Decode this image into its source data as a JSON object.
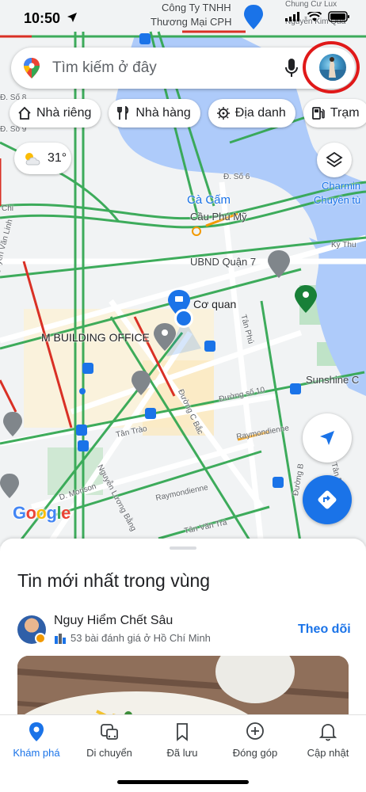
{
  "status": {
    "time": "10:50"
  },
  "search": {
    "placeholder": "Tìm kiếm ở đây"
  },
  "chips": [
    {
      "label": "Nhà riêng",
      "icon": "home-icon"
    },
    {
      "label": "Nhà hàng",
      "icon": "restaurant-icon"
    },
    {
      "label": "Địa danh",
      "icon": "landmark-icon"
    },
    {
      "label": "Trạm",
      "icon": "gas-station-icon"
    }
  ],
  "weather": {
    "temp": "31°"
  },
  "map": {
    "labels": {
      "cong_ty_1": "Công Ty TNHH",
      "cong_ty_2": "Thương Mại CPH",
      "nguyen_kim": "Nguyễn Kim Quả",
      "chung_cu": "Chung Cư Lux",
      "d_so_9": "Đ. Số 9",
      "d_so_8": "Đ. Số 8",
      "d_so_6": "Đ. Số 6",
      "ca_cam": "Cà Cấm",
      "cau_phu_my": "Cầu Phú Mỹ",
      "charming": "Charmin",
      "chuyen_tu": "Chuyên tù",
      "chi": "Chi",
      "ky_thu": "Kỳ Thu",
      "ubnd": "UBND Quận 7",
      "co_quan": "Cơ quan",
      "nguyen_van_linh": "Nguyễn Văn Linh",
      "m_building": "M BUILDING OFFICE",
      "tan_phu": "Tân Phú",
      "duong_so_10": "Đường số 10",
      "sunshine": "Sunshine C",
      "tan_trao": "Tân Trào",
      "duong_c_bac": "Đường C Bắc",
      "raymondienne_1": "Raymondienne",
      "raymondienne_2": "Raymondienne",
      "d_morison": "D. Morison",
      "nguyen_luong_bang": "Nguyễn Lương Bằng",
      "tan_van_tra": "Tân Văn Trà",
      "duong_b": "Đường B",
      "tan_phu_2": "Tân Phú",
      "google": "Google"
    }
  },
  "sheet": {
    "title": "Tin mới nhất trong vùng",
    "post": {
      "name": "Nguy Hiểm Chết Sâu",
      "meta": "53 bài đánh giá ở Hồ Chí Minh",
      "follow": "Theo dõi"
    }
  },
  "nav": [
    {
      "label": "Khám phá",
      "icon": "explore-pin-icon",
      "active": true
    },
    {
      "label": "Di chuyển",
      "icon": "commute-icon",
      "active": false
    },
    {
      "label": "Đã lưu",
      "icon": "bookmark-icon",
      "active": false
    },
    {
      "label": "Đóng góp",
      "icon": "add-circle-icon",
      "active": false
    },
    {
      "label": "Cập nhật",
      "icon": "bell-icon",
      "active": false
    }
  ],
  "colors": {
    "accent": "#1a73e8",
    "river": "#aecbfa",
    "road_green": "#34a853",
    "road_red": "#d93025",
    "highlight": "#e01919"
  }
}
